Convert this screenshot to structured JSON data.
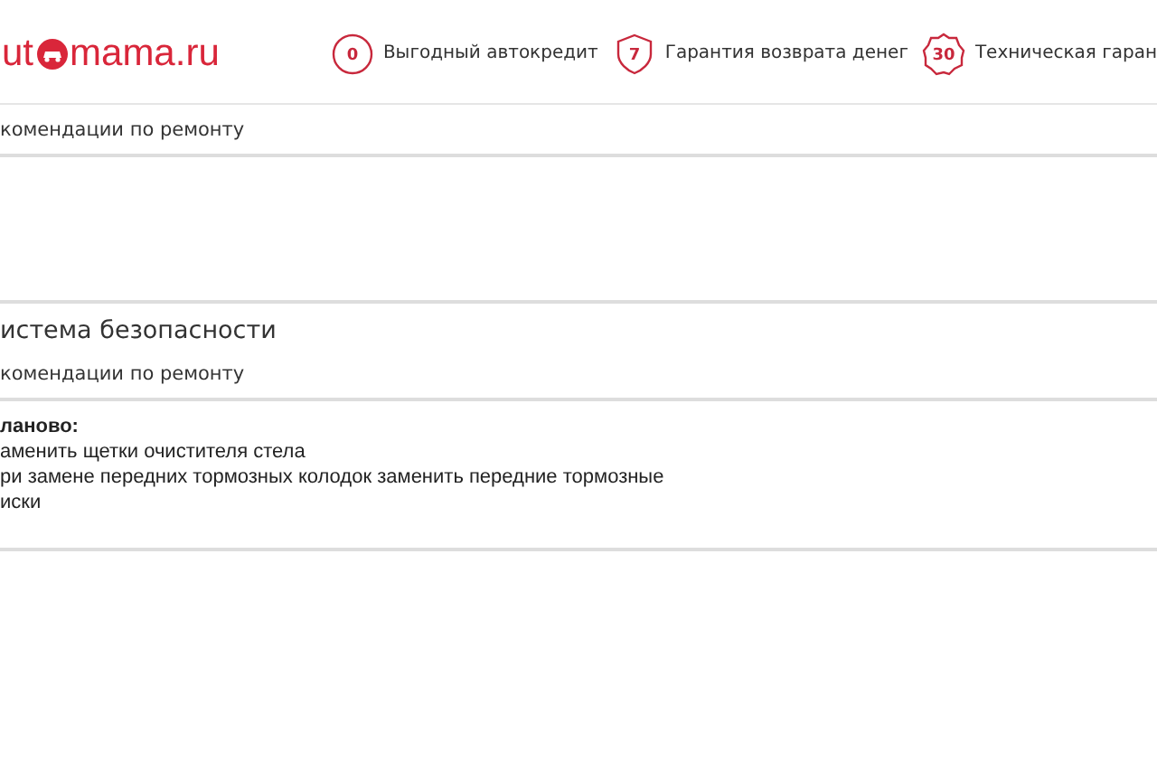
{
  "header": {
    "logo": {
      "before": "ut",
      "after": "mama.ru"
    },
    "features": [
      {
        "kind": "percent",
        "badge": "0",
        "label": "Выгодный автокредит"
      },
      {
        "kind": "shield",
        "badge": "7",
        "label": "Гарантия возврата денег"
      },
      {
        "kind": "seal",
        "badge": "30",
        "label": "Техническая гаран"
      }
    ]
  },
  "sections": [
    {
      "subtitle": "комендации по ремонту"
    },
    {
      "title": "истема безопасности",
      "subtitle": "комендации по ремонту",
      "notes": {
        "heading": "ланово:",
        "lines": [
          "аменить щетки очистителя стела",
          "ри замене передних тормозных колодок заменить передние тормозные",
          "иски"
        ]
      }
    }
  ]
}
